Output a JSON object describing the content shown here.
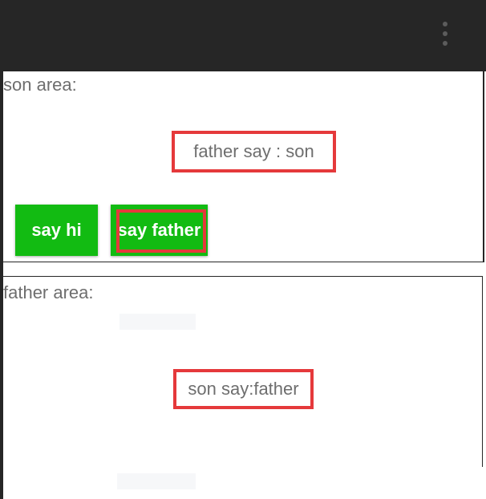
{
  "toolbar": {
    "background": "#262626",
    "overflow_icon": "more-vertical-icon"
  },
  "son_area": {
    "label": "son area:",
    "message": "father say : son",
    "buttons": {
      "say_hi": "say hi",
      "say_father": "say father"
    }
  },
  "father_area": {
    "label": "father area:",
    "message": "son say:father"
  },
  "colors": {
    "button": "#12bb12",
    "highlight": "#e5393b",
    "text": "#6e6e6e",
    "toolbar": "#262626"
  }
}
